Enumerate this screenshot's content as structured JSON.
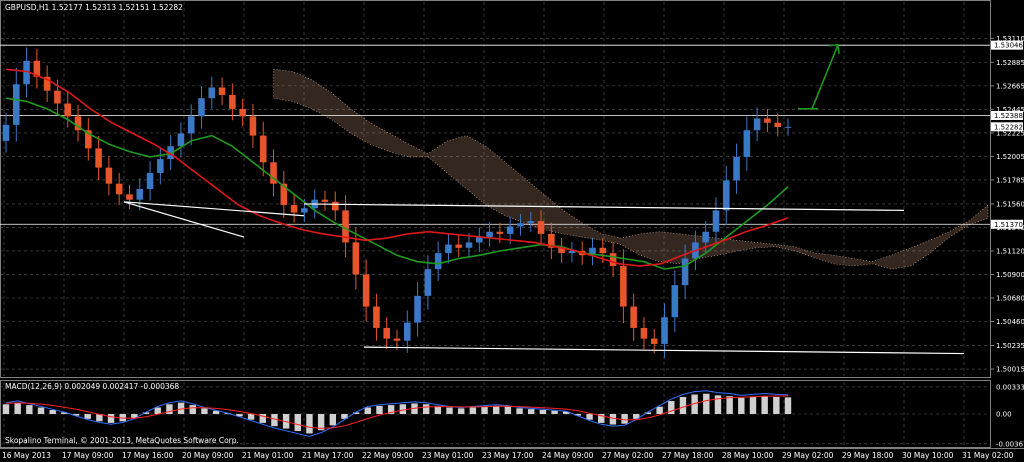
{
  "header": {
    "symbol_line": "GBPUSD,H1  1.52177 1.52313 1.52151 1.52282",
    "macd_line": "MACD(12,26,9) 0.002049 0.002417 -0.000368",
    "copyright": "Skopalino Terminal, © 2001-2013, MetaQuotes Software Corp."
  },
  "colors": {
    "background": "#000000",
    "grid": "#5a5a5a",
    "bull_candle": "#3b78c6",
    "bear_candle": "#e8552a",
    "ma_fast": "#1f9a1f",
    "ma_slow": "#e01818",
    "cloud": "#e8b090",
    "trendline": "#ffffff",
    "arrow": "#1f9a1f",
    "macd_hist": "#d0d0d0",
    "macd_line": "#3070ff",
    "signal_line": "#ff2020"
  },
  "chart_data": [
    {
      "type": "candlestick",
      "symbol": "GBPUSD",
      "timeframe": "H1",
      "ylim": [
        1.4995,
        1.5345
      ],
      "y_ticks": [
        "1.53110",
        "1.52885",
        "1.52665",
        "1.52445",
        "1.52225",
        "1.52005",
        "1.51785",
        "1.51560",
        "1.51340",
        "1.51120",
        "1.50900",
        "1.50680",
        "1.50460",
        "1.50235",
        "1.50015"
      ],
      "x_ticks": [
        "16 May 2013",
        "17 May 09:00",
        "17 May 16:00",
        "20 May 09:00",
        "21 May 01:00",
        "21 May 17:00",
        "22 May 09:00",
        "23 May 01:00",
        "23 May 17:00",
        "24 May 09:00",
        "27 May 02:00",
        "27 May 18:00",
        "28 May 10:00",
        "29 May 02:00",
        "29 May 18:00",
        "30 May 10:00",
        "31 May 02:00"
      ],
      "price_tags": [
        "1.53046",
        "1.52388",
        "1.52282",
        "1.51370"
      ],
      "horizontal_levels": [
        1.53046,
        1.52388,
        1.5137
      ],
      "close_series": [
        1.523,
        1.5268,
        1.529,
        1.5275,
        1.5262,
        1.525,
        1.5238,
        1.5225,
        1.5208,
        1.519,
        1.5175,
        1.5165,
        1.516,
        1.517,
        1.5185,
        1.5198,
        1.521,
        1.5222,
        1.5238,
        1.5255,
        1.5265,
        1.5258,
        1.5245,
        1.5238,
        1.522,
        1.5195,
        1.5175,
        1.5155,
        1.5148,
        1.5152,
        1.516,
        1.5158,
        1.515,
        1.512,
        1.509,
        1.506,
        1.504,
        1.503,
        1.5028,
        1.5045,
        1.507,
        1.5095,
        1.511,
        1.5118,
        1.5115,
        1.512,
        1.5125,
        1.513,
        1.5128,
        1.5135,
        1.5138,
        1.514,
        1.5128,
        1.5115,
        1.511,
        1.5112,
        1.5108,
        1.5115,
        1.511,
        1.5098,
        1.506,
        1.504,
        1.503,
        1.5025,
        1.505,
        1.508,
        1.5105,
        1.512,
        1.513,
        1.515,
        1.5178,
        1.52,
        1.5225,
        1.5236,
        1.5232,
        1.5228,
        1.52282
      ],
      "ma_fast_series": [
        1.5255,
        1.5252,
        1.5245,
        1.5235,
        1.5222,
        1.5212,
        1.5205,
        1.52,
        1.5203,
        1.5215,
        1.522,
        1.521,
        1.5195,
        1.518,
        1.5165,
        1.515,
        1.5138,
        1.5128,
        1.5118,
        1.5108,
        1.5102,
        1.51,
        1.5105,
        1.5108,
        1.5112,
        1.5115,
        1.5118,
        1.5116,
        1.511,
        1.5108,
        1.5105,
        1.5102,
        1.5095,
        1.5098,
        1.511,
        1.5125,
        1.514,
        1.5155,
        1.5172
      ],
      "ma_slow_series": [
        1.5282,
        1.528,
        1.5272,
        1.526,
        1.5245,
        1.5232,
        1.5222,
        1.5212,
        1.52,
        1.5185,
        1.517,
        1.5155,
        1.5145,
        1.5138,
        1.5132,
        1.5128,
        1.5125,
        1.5122,
        1.5124,
        1.5128,
        1.513,
        1.5128,
        1.5126,
        1.5124,
        1.5122,
        1.512,
        1.5116,
        1.5112,
        1.5106,
        1.51,
        1.5098,
        1.51,
        1.5108,
        1.5115,
        1.5122,
        1.513,
        1.5136,
        1.5143
      ],
      "trendlines": [
        {
          "from": [
            "21 May 17:00",
            1.5156
          ],
          "to": [
            "30 May 10:00",
            1.515
          ]
        },
        {
          "from": [
            "22 May 09:00",
            1.5022
          ],
          "to": [
            "31 May 02:00",
            1.5016
          ]
        },
        {
          "from": [
            "17 May 16:00",
            1.5158
          ],
          "to": [
            "21 May 01:00",
            1.5125
          ]
        },
        {
          "from": [
            "17 May 16:00",
            1.5158
          ],
          "to": [
            "21 May 17:00",
            1.5145
          ]
        }
      ],
      "arrow": {
        "from": 1.5245,
        "to": 1.5305
      }
    },
    {
      "type": "macd",
      "params": "12,26,9",
      "values": [
        0.002049,
        0.002417,
        -0.000368
      ],
      "y_ticks": [
        "0.003332",
        "0.00",
        "-0.003675"
      ],
      "ylim": [
        -0.0037,
        0.0037
      ],
      "histogram": [
        0.0012,
        0.0014,
        0.0011,
        0.0008,
        0.0005,
        0.0002,
        -0.0002,
        -0.0006,
        -0.0009,
        -0.0011,
        -0.0009,
        -0.0005,
        0.0002,
        0.0008,
        0.0012,
        0.0014,
        0.0011,
        0.0007,
        0.0004,
        0.0001,
        -0.0003,
        -0.0007,
        -0.0011,
        -0.0015,
        -0.0018,
        -0.0021,
        -0.0024,
        -0.002,
        -0.0014,
        -0.0006,
        0.0002,
        0.0008,
        0.001,
        0.0011,
        0.0012,
        0.0013,
        0.0012,
        0.001,
        0.0008,
        0.0007,
        0.0008,
        0.0009,
        0.001,
        0.0009,
        0.0007,
        0.0006,
        0.0005,
        0.0004,
        0.0003,
        -0.0002,
        -0.0007,
        -0.0011,
        -0.0013,
        -0.0012,
        -0.0006,
        0.0002,
        0.0009,
        0.0016,
        0.0021,
        0.0024,
        0.0025,
        0.0023,
        0.0022,
        0.002,
        0.0021,
        0.0022,
        0.0021,
        0.00205
      ]
    }
  ]
}
